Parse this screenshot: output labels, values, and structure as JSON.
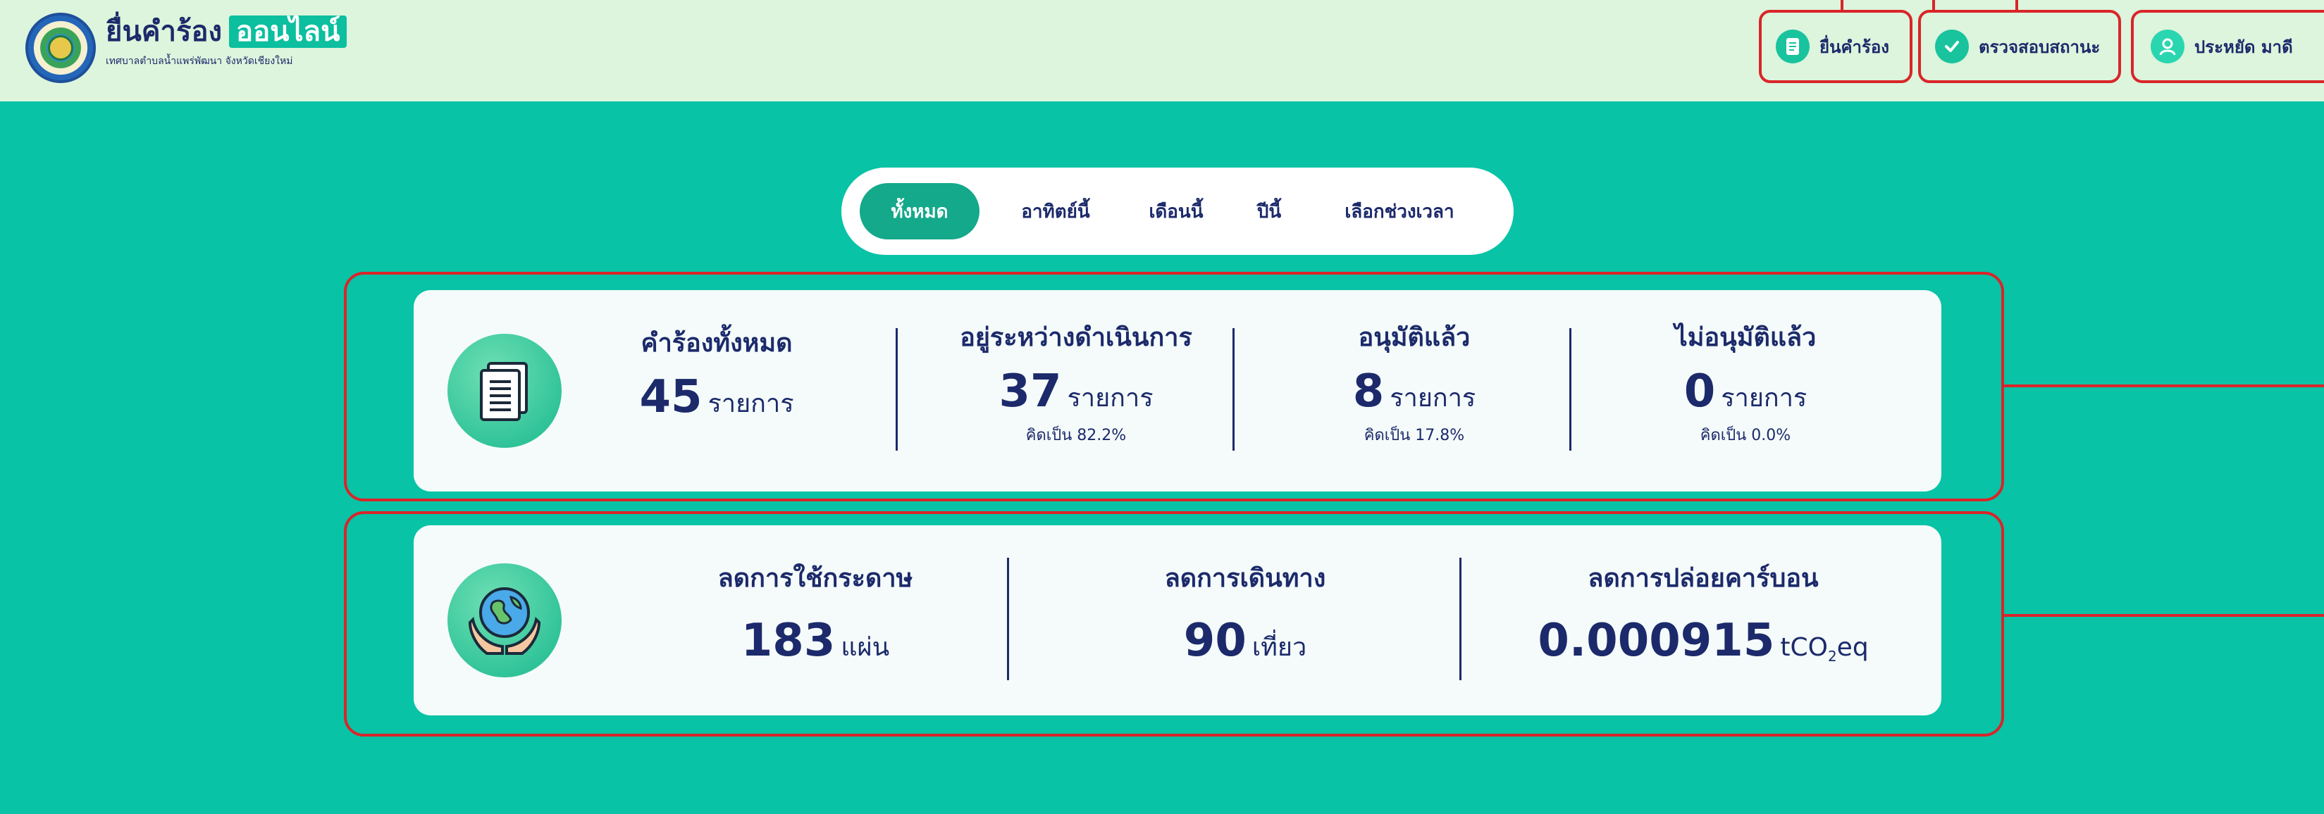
{
  "header": {
    "title": "ยื่นคำร้อง",
    "title_highlight": "ออนไลน์",
    "subtitle": "เทศบาลตำบลน้ำแพร่พัฒนา จังหวัดเชียงใหม่",
    "nav": {
      "submit_label": "ยื่นคำร้อง",
      "check_status_label": "ตรวจสอบสถานะ",
      "user_name": "ประหยัด มาดี"
    }
  },
  "filters": {
    "items": [
      "ทั้งหมด",
      "อาทิตย์นี้",
      "เดือนนี้",
      "ปีนี้",
      "เลือกช่วงเวลา"
    ],
    "active": "ทั้งหมด"
  },
  "requests_card": {
    "icon": "document-icon",
    "total": {
      "label": "คำร้องทั้งหมด",
      "value": "45",
      "unit": "รายการ"
    },
    "in_progress": {
      "label": "อยู่ระหว่างดำเนินการ",
      "value": "37",
      "unit": "รายการ",
      "percent_text": "คิดเป็น 82.2%"
    },
    "approved": {
      "label": "อนุมัติแล้ว",
      "value": "8",
      "unit": "รายการ",
      "percent_text": "คิดเป็น 17.8%"
    },
    "not_approved": {
      "label": "ไม่อนุมัติแล้ว",
      "value": "0",
      "unit": "รายการ",
      "percent_text": "คิดเป็น 0.0%"
    }
  },
  "environment_card": {
    "icon": "globe-hands-icon",
    "paper": {
      "label": "ลดการใช้กระดาษ",
      "value": "183",
      "unit": "แผ่น"
    },
    "travel": {
      "label": "ลดการเดินทาง",
      "value": "90",
      "unit": "เที่ยว"
    },
    "carbon": {
      "label": "ลดการปล่อยคาร์บอน",
      "value": "0.000915",
      "unit_prefix": "tCO",
      "unit_sub": "2",
      "unit_suffix": "eq"
    }
  },
  "colors": {
    "background": "#08c3a6",
    "header_bg": "#dcf5dc",
    "primary_text": "#1c2a6b",
    "accent": "#13a98a",
    "highlight_outline": "#d9252a"
  }
}
